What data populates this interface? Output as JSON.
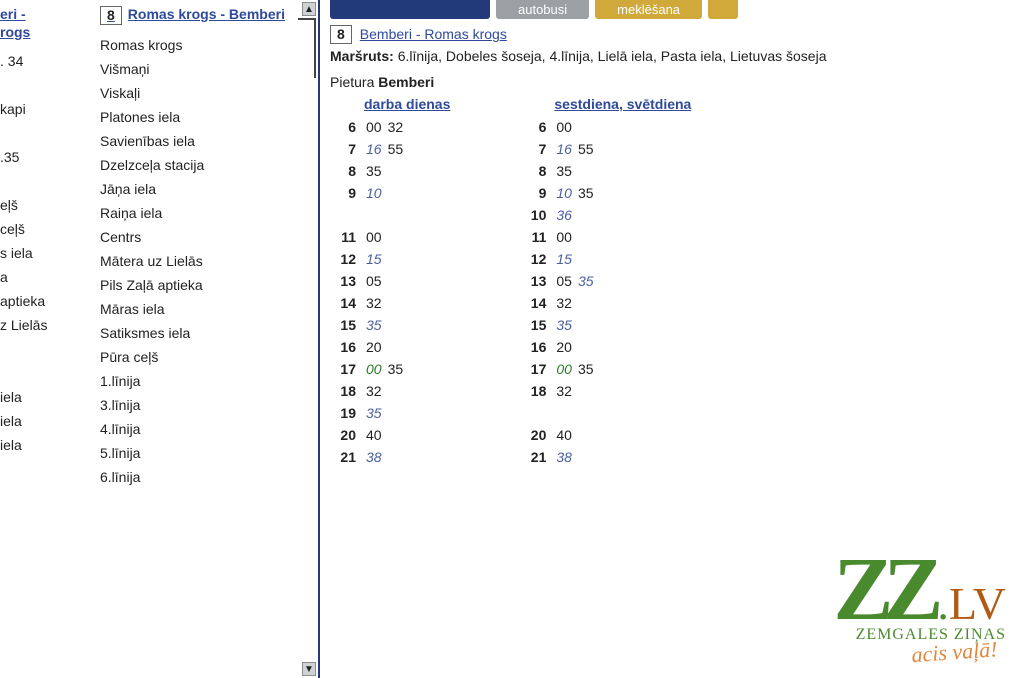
{
  "left": {
    "routeA": {
      "title_fragment_1": "eri -",
      "title_fragment_2": "rogs"
    },
    "stopsA": [
      ". 34",
      "",
      "kapi",
      "",
      ".35",
      "",
      "eļš",
      "ceļš",
      "s iela",
      "a",
      "aptieka",
      "z Lielās",
      "",
      "",
      "iela",
      "iela",
      "iela"
    ],
    "routeB": {
      "num": "8",
      "title": "Romas krogs - Bemberi"
    },
    "stopsB": [
      "Romas krogs",
      "Višmaņi",
      "Viskaļi",
      "Platones iela",
      "Savienības iela",
      "Dzelzceļa stacija",
      "Jāņa iela",
      "Raiņa iela",
      "Centrs",
      "Mātera uz Lielās",
      "Pils Zaļā aptieka",
      "Māras iela",
      "Satiksmes iela",
      "Pūra ceļš",
      "1.līnija",
      "3.līnija",
      "4.līnija",
      "5.līnija",
      "6.līnija"
    ]
  },
  "tabs": {
    "gray": "autobusi",
    "gold": "meklēšana"
  },
  "route": {
    "num": "8",
    "title": "Bemberi - Romas krogs"
  },
  "marsruts_label": "Maršruts:",
  "marsruts_text": "6.līnija, Dobeles šoseja, 4.līnija, Lielā iela, Pasta iela, Lietuvas šoseja",
  "pietura_label": "Pietura",
  "pietura_name": "Bemberi",
  "sched": {
    "weekday_label": "darba dienas",
    "weekend_label": "sestdiena, svētdiena",
    "weekday": [
      {
        "h": "6",
        "m": [
          {
            "t": "00"
          },
          {
            "t": "32"
          }
        ]
      },
      {
        "h": "7",
        "m": [
          {
            "t": "16",
            "c": "italic"
          },
          {
            "t": "55"
          }
        ]
      },
      {
        "h": "8",
        "m": [
          {
            "t": "35"
          }
        ]
      },
      {
        "h": "9",
        "m": [
          {
            "t": "10",
            "c": "italic"
          }
        ]
      },
      {
        "h": "",
        "m": []
      },
      {
        "h": "11",
        "m": [
          {
            "t": "00"
          }
        ]
      },
      {
        "h": "12",
        "m": [
          {
            "t": "15",
            "c": "italic"
          }
        ]
      },
      {
        "h": "13",
        "m": [
          {
            "t": "05"
          }
        ]
      },
      {
        "h": "14",
        "m": [
          {
            "t": "32"
          }
        ]
      },
      {
        "h": "15",
        "m": [
          {
            "t": "35",
            "c": "italic"
          }
        ]
      },
      {
        "h": "16",
        "m": [
          {
            "t": "20"
          }
        ]
      },
      {
        "h": "17",
        "m": [
          {
            "t": "00",
            "c": "green"
          },
          {
            "t": "35"
          }
        ]
      },
      {
        "h": "18",
        "m": [
          {
            "t": "32"
          }
        ]
      },
      {
        "h": "19",
        "m": [
          {
            "t": "35",
            "c": "italic"
          }
        ]
      },
      {
        "h": "20",
        "m": [
          {
            "t": "40"
          }
        ]
      },
      {
        "h": "21",
        "m": [
          {
            "t": "38",
            "c": "italic"
          }
        ]
      }
    ],
    "weekend": [
      {
        "h": "6",
        "m": [
          {
            "t": "00"
          }
        ]
      },
      {
        "h": "7",
        "m": [
          {
            "t": "16",
            "c": "italic"
          },
          {
            "t": "55"
          }
        ]
      },
      {
        "h": "8",
        "m": [
          {
            "t": "35"
          }
        ]
      },
      {
        "h": "9",
        "m": [
          {
            "t": "10",
            "c": "italic"
          },
          {
            "t": "35"
          }
        ]
      },
      {
        "h": "10",
        "m": [
          {
            "t": "36",
            "c": "italic"
          }
        ]
      },
      {
        "h": "11",
        "m": [
          {
            "t": "00"
          }
        ]
      },
      {
        "h": "12",
        "m": [
          {
            "t": "15",
            "c": "italic"
          }
        ]
      },
      {
        "h": "13",
        "m": [
          {
            "t": "05"
          },
          {
            "t": "35",
            "c": "italic"
          }
        ]
      },
      {
        "h": "14",
        "m": [
          {
            "t": "32"
          }
        ]
      },
      {
        "h": "15",
        "m": [
          {
            "t": "35",
            "c": "italic"
          }
        ]
      },
      {
        "h": "16",
        "m": [
          {
            "t": "20"
          }
        ]
      },
      {
        "h": "17",
        "m": [
          {
            "t": "00",
            "c": "green"
          },
          {
            "t": "35"
          }
        ]
      },
      {
        "h": "18",
        "m": [
          {
            "t": "32"
          }
        ]
      },
      {
        "h": "",
        "m": []
      },
      {
        "h": "20",
        "m": [
          {
            "t": "40"
          }
        ]
      },
      {
        "h": "21",
        "m": [
          {
            "t": "38",
            "c": "italic"
          }
        ]
      }
    ]
  },
  "logo": {
    "zz": "ZZ",
    "dot_lv": ".LV",
    "sub": "ZEMGALES ZIŅAS",
    "slogan": "acis vaļā!"
  }
}
